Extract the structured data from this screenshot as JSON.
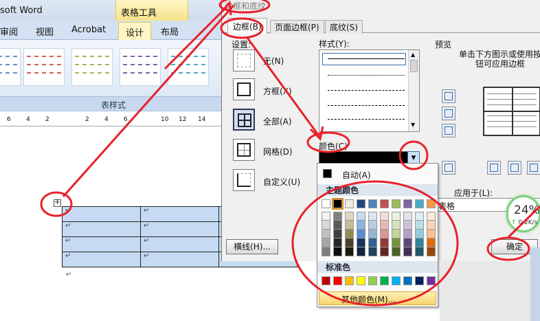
{
  "word": {
    "title": "soft Word",
    "context_tab": "表格工具",
    "tabs": [
      "审阅",
      "视图",
      "Acrobat",
      "设计",
      "布局"
    ],
    "group_label": "表样式",
    "ruler_numbers": [
      "6",
      "4",
      "2",
      "2",
      "4",
      "6",
      "10",
      "12",
      "14"
    ]
  },
  "dialog": {
    "title": "边框和底纹",
    "tabs": [
      "边框(B)",
      "页面边框(P)",
      "底纹(S)"
    ],
    "setting_label": "设置:",
    "settings": [
      {
        "label": "无(N)",
        "icon": "border-none-icon"
      },
      {
        "label": "方框(X)",
        "icon": "border-box-icon"
      },
      {
        "label": "全部(A)",
        "icon": "border-all-icon"
      },
      {
        "label": "网格(D)",
        "icon": "border-grid-icon"
      },
      {
        "label": "自定义(U)",
        "icon": "border-custom-icon"
      }
    ],
    "style_label": "样式(Y):",
    "color_label": "颜色(C)",
    "preview_label": "预览",
    "preview_hint": "单击下方图示或使用按钮可应用边框",
    "apply_label": "应用于(L):",
    "apply_value": "表格",
    "hline_button": "横线(H)...",
    "ok_button": "确定"
  },
  "palette": {
    "auto_label": "自动(A)",
    "theme_label": "主题颜色",
    "standard_label": "标准色",
    "more_label": "其他颜色(M)...",
    "theme_colors": [
      "#ffffff",
      "#000000",
      "#eeece1",
      "#1f497d",
      "#4f81bd",
      "#c0504d",
      "#9bbb59",
      "#8064a2",
      "#4bacc6",
      "#f79646"
    ],
    "shades": [
      [
        "#f2f2f2",
        "#d8d8d8",
        "#bfbfbf",
        "#a5a5a5",
        "#7f7f7f"
      ],
      [
        "#7f7f7f",
        "#595959",
        "#3f3f3f",
        "#262626",
        "#0c0c0c"
      ],
      [
        "#ddd9c3",
        "#c4bd97",
        "#938953",
        "#494429",
        "#1d1b10"
      ],
      [
        "#c6d9f0",
        "#8db3e2",
        "#548dd4",
        "#17365d",
        "#0f243e"
      ],
      [
        "#dbe5f1",
        "#b8cce4",
        "#95b3d7",
        "#366092",
        "#244061"
      ],
      [
        "#f2dcdb",
        "#e5b9b7",
        "#d99694",
        "#953734",
        "#632423"
      ],
      [
        "#ebf1dd",
        "#d7e3bc",
        "#c3d69b",
        "#76923c",
        "#4f6128"
      ],
      [
        "#e5e0ec",
        "#ccc1d9",
        "#b2a2c7",
        "#5f497a",
        "#3f3151"
      ],
      [
        "#dbeef3",
        "#b7dde8",
        "#92cddc",
        "#31859b",
        "#205867"
      ],
      [
        "#fdeada",
        "#fbd5b5",
        "#fac08f",
        "#e36c09",
        "#974806"
      ]
    ],
    "standard_colors": [
      "#c00000",
      "#ff0000",
      "#ffc000",
      "#ffff00",
      "#92d050",
      "#00b050",
      "#00b0f0",
      "#0070c0",
      "#002060",
      "#7030a0"
    ]
  },
  "netmon": {
    "percent": "24%",
    "speed": "0.2K/s"
  },
  "annotation_color": "#e8202a"
}
